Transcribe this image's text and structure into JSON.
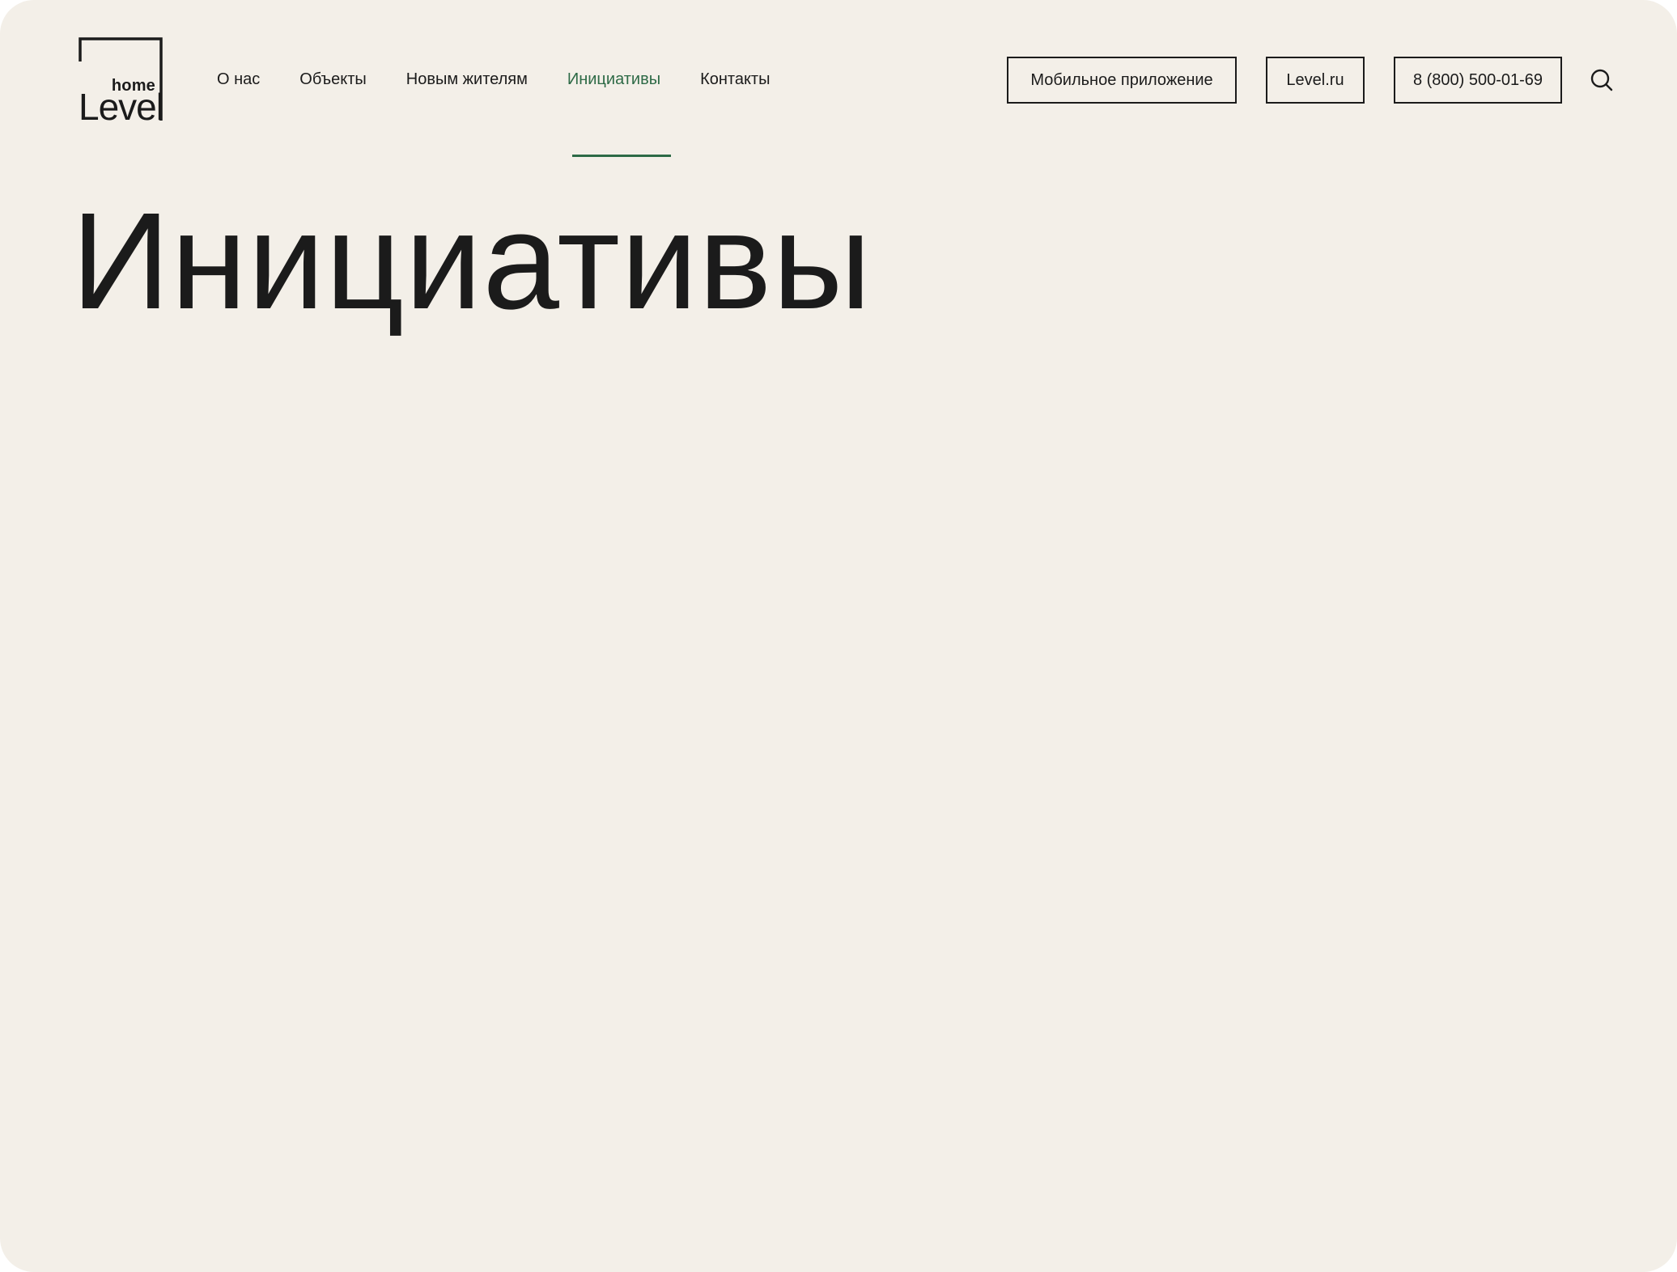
{
  "logo": {
    "top_text": "home",
    "main_text": "Level"
  },
  "nav": {
    "items": [
      {
        "label": "О нас"
      },
      {
        "label": "Объекты"
      },
      {
        "label": "Новым жителям"
      },
      {
        "label": "Инициативы",
        "active": true
      },
      {
        "label": "Контакты"
      }
    ]
  },
  "header": {
    "app_button": "Мобильное приложение",
    "site_button": "Level.ru",
    "phone_button": "8 (800) 500-01-69",
    "search_icon": "search-icon"
  },
  "main": {
    "title": "Инициативы"
  },
  "colors": {
    "background": "#f3efe8",
    "text": "#1b1b1b",
    "accent": "#2d6a46"
  }
}
